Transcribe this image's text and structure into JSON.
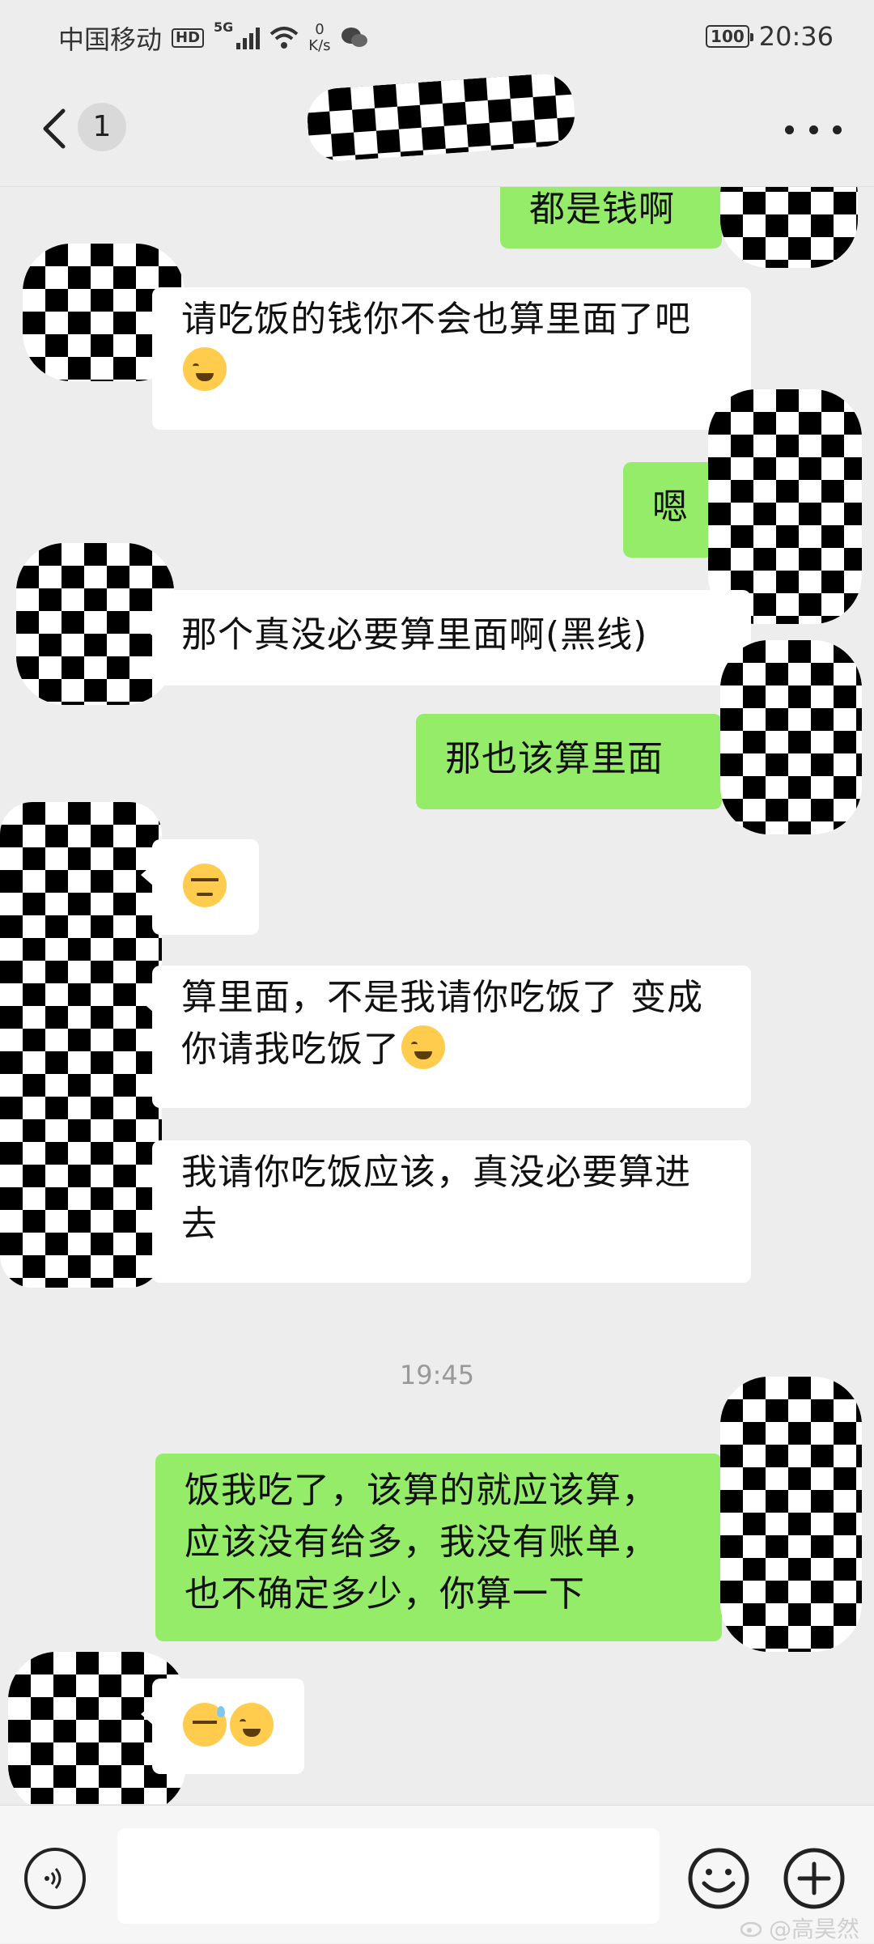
{
  "status_bar": {
    "carrier": "中国移动",
    "hd": "HD",
    "net_type": "5G",
    "speed_value": "0",
    "speed_unit": "K/s",
    "battery": "100",
    "time": "20:36"
  },
  "nav": {
    "unread_count": "1"
  },
  "messages": [
    {
      "side": "right",
      "text": "都是钱啊"
    },
    {
      "side": "left",
      "text": "请吃饭的钱你不会也算里面了吧",
      "emoji": "cry"
    },
    {
      "side": "right",
      "text": "嗯"
    },
    {
      "side": "left",
      "text": "那个真没必要算里面啊(黑线)"
    },
    {
      "side": "right",
      "text": "那也该算里面"
    },
    {
      "side": "left",
      "text": "",
      "emoji": "unamused"
    },
    {
      "side": "left",
      "text": "算里面，不是我请你吃饭了 变成你请我吃饭了",
      "emoji": "cry"
    },
    {
      "side": "left",
      "text": "我请你吃饭应该，真没必要算进去"
    },
    {
      "side": "right",
      "text": "饭我吃了，该算的就应该算，应该没有给多，我没有账单，也不确定多少，你算一下"
    },
    {
      "side": "left",
      "text": "",
      "emoji": "sweat",
      "emoji2": "cry"
    }
  ],
  "time_divider": "19:45",
  "input": {
    "value": ""
  },
  "icons": {
    "voice": "voice-icon",
    "emoji": "emoji-icon",
    "plus": "plus-icon"
  },
  "watermark": "@高昊然",
  "colors": {
    "background": "#ededed",
    "bubble_self": "#95ec69",
    "bubble_other": "#ffffff",
    "timestamp": "#999999"
  }
}
